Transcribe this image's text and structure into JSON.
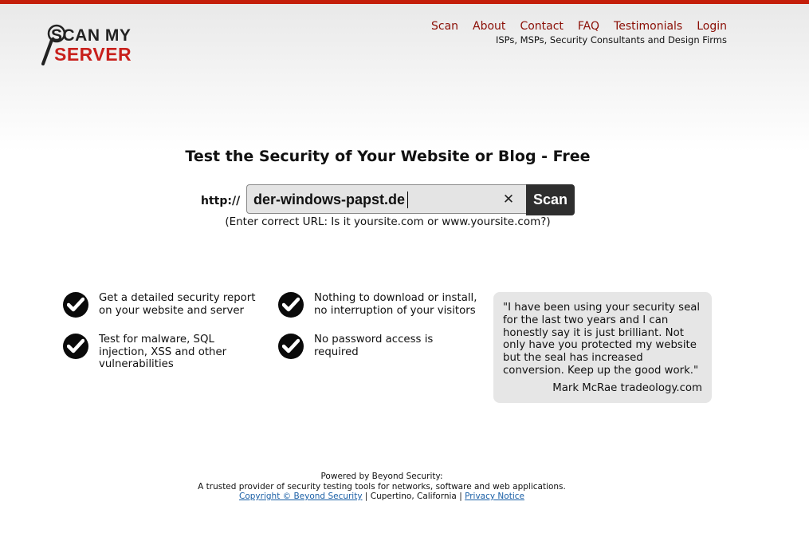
{
  "logo": {
    "line1": "SCAN MY",
    "line2": "SERVER"
  },
  "nav": {
    "items": [
      "Scan",
      "About",
      "Contact",
      "FAQ",
      "Testimonials",
      "Login"
    ],
    "tagline": "ISPs, MSPs, Security Consultants and Design Firms"
  },
  "main": {
    "heading": "Test the Security of Your Website or Blog - Free",
    "url_prefix": "http://",
    "url_value": "der-windows-papst.de",
    "clear_label": "✕",
    "scan_label": "Scan",
    "hint": "(Enter correct URL: Is it yoursite.com or www.yoursite.com?)"
  },
  "features": [
    {
      "line1": "Get a detailed security report",
      "line2": "on your website and server",
      "line3": ""
    },
    {
      "line1": "Nothing to download or install,",
      "line2": "no interruption of your visitors",
      "line3": ""
    },
    {
      "line1": "Test for malware, SQL",
      "line2": "injection, XSS and other",
      "line3": "vulnerabilities"
    },
    {
      "line1": "No password access is",
      "line2": "required",
      "line3": ""
    }
  ],
  "testimonial": {
    "lines": [
      "\"I have been using your security seal",
      "for the last two years and I can",
      "honestly say it is just brilliant. Not",
      "only have you protected my website",
      "but the seal has increased",
      "conversion. Keep up the good work.\""
    ],
    "author": "Mark McRae tradeology.com"
  },
  "footer": {
    "powered": "Powered by Beyond Security:",
    "provider": "A trusted provider of security testing tools for networks, software and web applications.",
    "copyright_link": "Copyright © Beyond Security",
    "location": " | Cupertino, California | ",
    "privacy_link": "Privacy Notice"
  },
  "colors": {
    "accent": "#c41e0a",
    "nav_link": "#8b0f06",
    "button": "#2e2e2e"
  }
}
